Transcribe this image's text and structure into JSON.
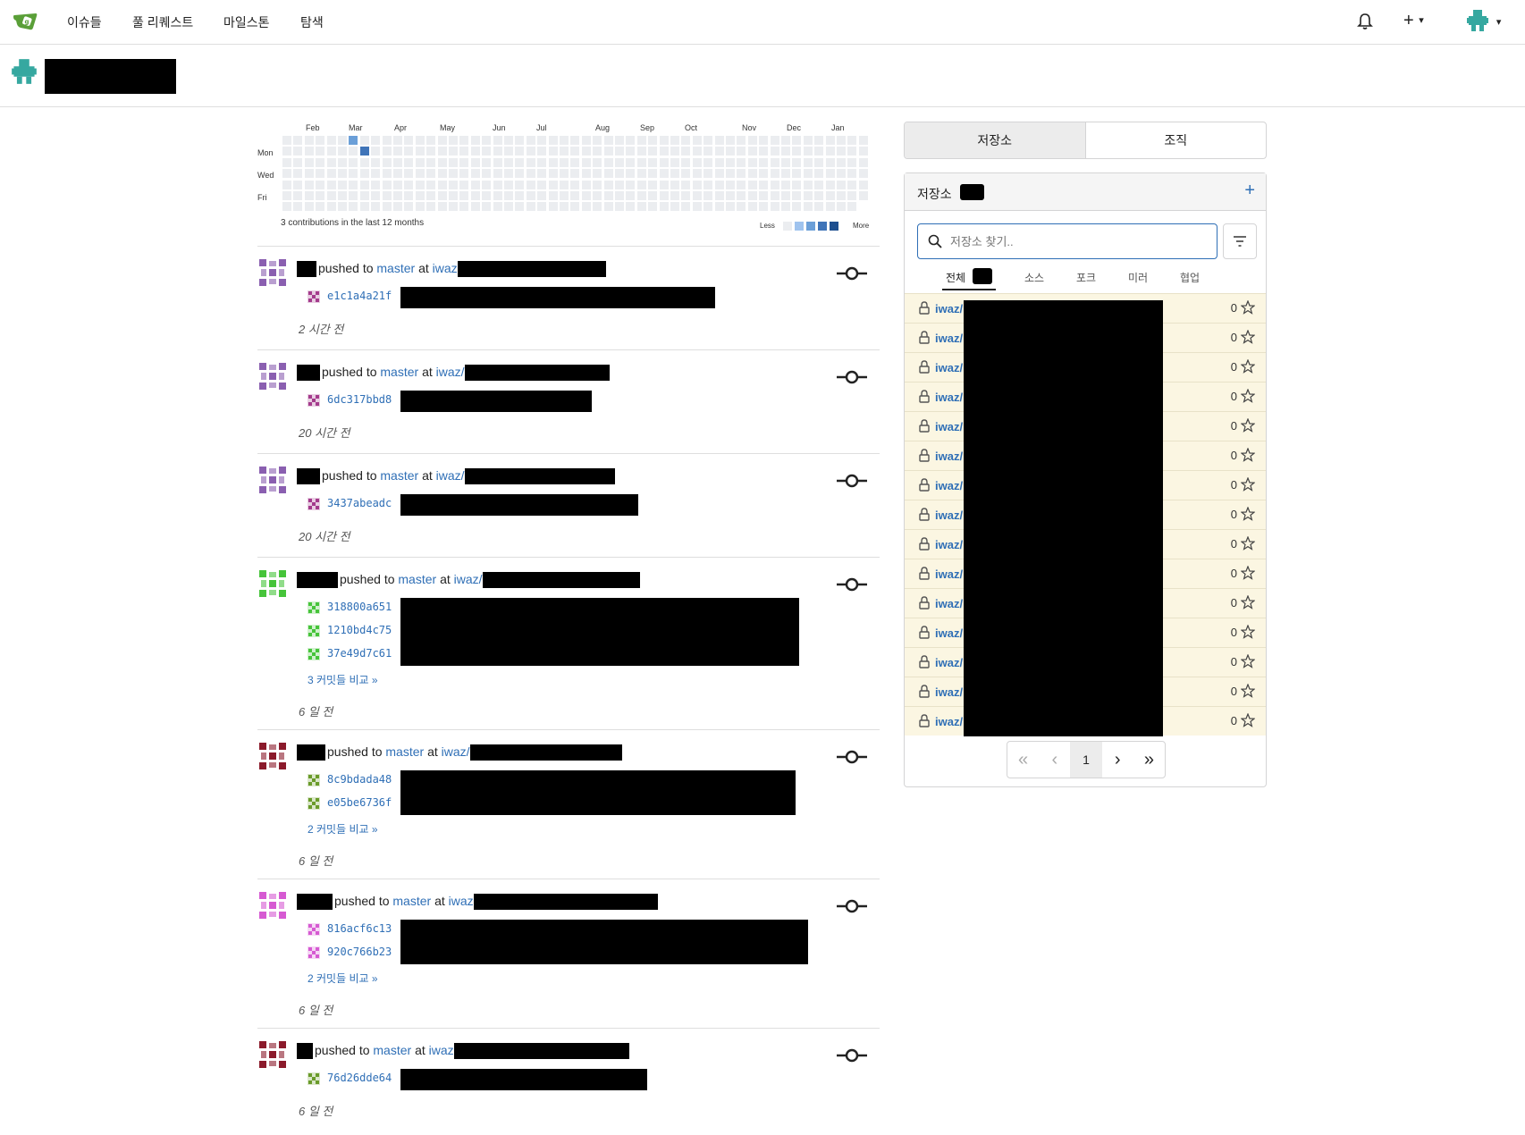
{
  "nav": {
    "items": [
      "이슈들",
      "풀 리퀘스트",
      "마일스톤",
      "탐색"
    ],
    "plus": "+",
    "dropdown_caret": "▾"
  },
  "heatmap": {
    "months": [
      "Feb",
      "Mar",
      "Apr",
      "May",
      "Jun",
      "Jul",
      "Aug",
      "Sep",
      "Oct",
      "Nov",
      "Dec",
      "Jan"
    ],
    "days": [
      "Mon",
      "Wed",
      "Fri"
    ],
    "summary": "3 contributions in the last 12 months",
    "less": "Less",
    "more": "More",
    "legend_colors": [
      "#ebedf0",
      "#9fc3ee",
      "#6b9fd8",
      "#3f74b8",
      "#1d4f8f"
    ]
  },
  "feed": [
    {
      "actor_redacted": true,
      "action": "pushed to",
      "branch": "master",
      "at": "at",
      "repo_prefix": "iwaz",
      "avatar_color": "#8a5fb0",
      "commits": [
        {
          "sha": "e1c1a4a21f",
          "color": "#a43b8c"
        }
      ],
      "compare": "",
      "time": "2 시간 전"
    },
    {
      "actor_redacted": true,
      "action": "pushed to",
      "branch": "master",
      "at": "at",
      "repo_prefix": "iwaz/",
      "avatar_color": "#8a5fb0",
      "commits": [
        {
          "sha": "6dc317bbd8",
          "color": "#a43b8c"
        }
      ],
      "compare": "",
      "time": "20 시간 전"
    },
    {
      "actor_redacted": true,
      "action": "pushed to",
      "branch": "master",
      "at": "at",
      "repo_prefix": "iwaz/",
      "avatar_color": "#8a5fb0",
      "commits": [
        {
          "sha": "3437abeadc",
          "color": "#a43b8c"
        }
      ],
      "compare": "",
      "time": "20 시간 전"
    },
    {
      "actor_redacted": true,
      "action": "pushed to",
      "branch": "master",
      "at": "at",
      "repo_prefix": "iwaz/",
      "avatar_color": "#46c43a",
      "commits": [
        {
          "sha": "318800a651",
          "color": "#46c43a"
        },
        {
          "sha": "1210bd4c75",
          "color": "#46c43a"
        },
        {
          "sha": "37e49d7c61",
          "color": "#46c43a"
        }
      ],
      "compare": "3 커밋들 비교 »",
      "time": "6 일 전"
    },
    {
      "actor_redacted": true,
      "action": "pushed to",
      "branch": "master",
      "at": "at",
      "repo_prefix": "iwaz/",
      "avatar_color": "#8b1a2b",
      "commits": [
        {
          "sha": "8c9bdada48",
          "color": "#6a9b2a"
        },
        {
          "sha": "e05be6736f",
          "color": "#6a9b2a"
        }
      ],
      "compare": "2 커밋들 비교 »",
      "time": "6 일 전"
    },
    {
      "actor_redacted": true,
      "action": "pushed to",
      "branch": "master",
      "at": "at",
      "repo_prefix": "iwaz",
      "avatar_color": "#d65ad2",
      "commits": [
        {
          "sha": "816acf6c13",
          "color": "#d65ad2"
        },
        {
          "sha": "920c766b23",
          "color": "#d65ad2"
        }
      ],
      "compare": "2 커밋들 비교 »",
      "time": "6 일 전"
    },
    {
      "actor_redacted": true,
      "action": "pushed to",
      "branch": "master",
      "at": "at",
      "repo_prefix": "iwaz",
      "avatar_color": "#8b1a2b",
      "commits": [
        {
          "sha": "76d26dde64",
          "color": "#6a9b2a"
        }
      ],
      "compare": "",
      "time": "6 일 전"
    }
  ],
  "right": {
    "tabs": [
      "저장소",
      "조직"
    ],
    "repo_header": "저장소",
    "add": "+",
    "search_placeholder": "저장소 찾기..",
    "subtabs": [
      "전체",
      "소스",
      "포크",
      "미러",
      "협업"
    ],
    "repo_prefix": "iwaz/",
    "repo_count": 15,
    "star_count": "0",
    "pager": [
      "«",
      "‹",
      "1",
      "›",
      "»"
    ]
  }
}
